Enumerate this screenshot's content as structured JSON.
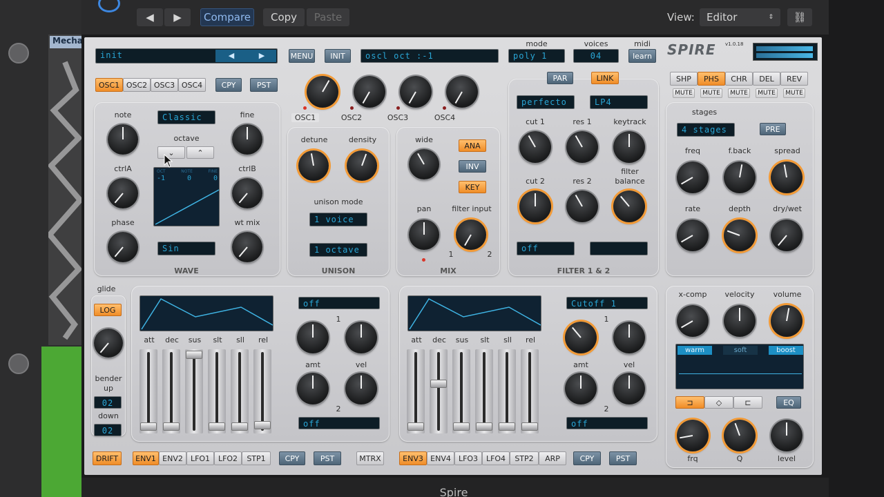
{
  "host": {
    "compare": "Compare",
    "copy": "Copy",
    "paste": "Paste",
    "view_label": "View:",
    "view_value": "Editor",
    "track_name": "Mecha",
    "plugin_name": "Spire"
  },
  "header": {
    "preset": "init",
    "menu": "MENU",
    "init": "INIT",
    "param_display": "oscl oct    :-1",
    "mode_label": "mode",
    "mode_value": "poly 1",
    "voices_label": "voices",
    "voices_value": "04",
    "midi_label": "midi",
    "midi_learn": "learn",
    "logo": "SPIRE",
    "version": "v1.0.18"
  },
  "osc": {
    "tabs": [
      "OSC1",
      "OSC2",
      "OSC3",
      "OSC4"
    ],
    "cpy": "CPY",
    "pst": "PST",
    "note": "note",
    "fine": "fine",
    "octave": "octave",
    "classic": "Classic",
    "ctrla": "ctrlA",
    "ctrlb": "ctrlB",
    "phase": "phase",
    "wt_mix": "wt mix",
    "wave_type": "Sin",
    "wave_title": "WAVE",
    "readout": [
      "OCT",
      "NOTE",
      "FINE"
    ],
    "readout_values": [
      "-1",
      "0",
      "0"
    ],
    "level_labels": [
      "OSC1",
      "OSC2",
      "OSC3",
      "OSC4"
    ]
  },
  "unison": {
    "detune": "detune",
    "density": "density",
    "mode_label": "unison mode",
    "voice": "1 voice",
    "octave": "1 octave",
    "title": "UNISON"
  },
  "mix": {
    "wide": "wide",
    "ana": "ANA",
    "inv": "INV",
    "key": "KEY",
    "pan": "pan",
    "filter_input": "filter input",
    "one": "1",
    "two": "2",
    "title": "MIX"
  },
  "filter": {
    "par": "PAR",
    "link": "LINK",
    "type1": "perfecto",
    "mode1": "LP4",
    "cut1": "cut 1",
    "res1": "res 1",
    "keytrack": "keytrack",
    "balance": "filter balance",
    "cut2": "cut 2",
    "res2": "res 2",
    "type2": "off",
    "title": "FILTER 1 & 2"
  },
  "fx": {
    "tabs": [
      "SHP",
      "PHS",
      "CHR",
      "DEL",
      "REV"
    ],
    "mute": "MUTE",
    "stages": "stages",
    "stages_value": "4 stages",
    "pre": "PRE",
    "freq": "freq",
    "fback": "f.back",
    "spread": "spread",
    "rate": "rate",
    "depth": "depth",
    "drywet": "dry/wet"
  },
  "output": {
    "xcomp": "x-comp",
    "velocity": "velocity",
    "volume": "volume",
    "warm": "warm",
    "soft": "soft",
    "boost": "boost",
    "eq": "EQ",
    "frq": "frq",
    "q": "Q",
    "level": "level"
  },
  "left": {
    "glide": "glide",
    "log": "LOG",
    "bender": "bender",
    "up": "up",
    "up_value": "02",
    "down": "down",
    "down_value": "02",
    "drift": "DRIFT"
  },
  "env": {
    "labels": [
      "att",
      "dec",
      "sus",
      "slt",
      "sll",
      "rel"
    ],
    "left_tabs": [
      "ENV1",
      "ENV2",
      "LFO1",
      "LFO2",
      "STP1"
    ],
    "right_tabs": [
      "ENV3",
      "ENV4",
      "LFO3",
      "LFO4",
      "STP2",
      "ARP"
    ],
    "cpy": "CPY",
    "pst": "PST",
    "mtrx": "MTRX",
    "left_dest1": "off",
    "left_dest2": "off",
    "right_dest1": "Cutoff 1",
    "right_dest2": "off",
    "amt": "amt",
    "vel": "vel",
    "one": "1",
    "two": "2"
  },
  "colors": {
    "accent": "#f29a36",
    "lcd_text": "#29a6d6"
  }
}
